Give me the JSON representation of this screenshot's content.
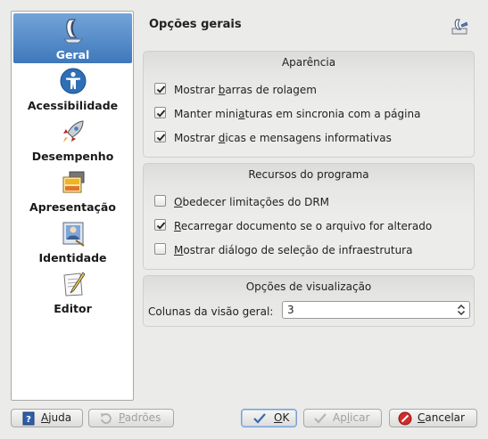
{
  "sidebar": {
    "items": [
      {
        "label": "Geral",
        "icon": "general-icon",
        "selected": true
      },
      {
        "label": "Acessibilidade",
        "icon": "accessibility-icon"
      },
      {
        "label": "Desempenho",
        "icon": "rocket-icon"
      },
      {
        "label": "Apresentação",
        "icon": "presentation-icon"
      },
      {
        "label": "Identidade",
        "icon": "identity-icon"
      },
      {
        "label": "Editor",
        "icon": "editor-icon"
      }
    ]
  },
  "header": {
    "title": "Opções gerais",
    "icon": "general-settings-icon"
  },
  "groups": {
    "appearance": {
      "title": "Aparência",
      "options": [
        {
          "pre": "Mostrar ",
          "mn": "b",
          "post": "arras de rolagem",
          "checked": true
        },
        {
          "pre": "Manter mini",
          "mn": "a",
          "post": "turas em sincronia com a página",
          "checked": true
        },
        {
          "pre": "Mostrar ",
          "mn": "d",
          "post": "icas e mensagens informativas",
          "checked": true
        }
      ]
    },
    "resources": {
      "title": "Recursos do programa",
      "options": [
        {
          "pre": "",
          "mn": "O",
          "post": "bedecer limitações do DRM",
          "checked": false
        },
        {
          "pre": "",
          "mn": "R",
          "post": "ecarregar documento se o arquivo for alterado",
          "checked": true
        },
        {
          "pre": "",
          "mn": "M",
          "post": "ostrar diálogo de seleção de infraestrutura",
          "checked": false
        }
      ]
    },
    "view": {
      "title": "Opções de visualização",
      "columns_label": "Colunas da visão geral:",
      "columns_value": "3"
    }
  },
  "buttons": {
    "help": {
      "mn": "A",
      "post": "juda"
    },
    "defaults": {
      "mn": "P",
      "post": "adrões"
    },
    "ok": {
      "mn": "O",
      "post": "K"
    },
    "apply": {
      "pre": "Ap",
      "mn": "l",
      "post": "icar"
    },
    "cancel": {
      "mn": "C",
      "post": "ancelar"
    }
  },
  "colors": {
    "selection": "#4f86c6",
    "cancel_icon": "#d22b2b",
    "check": "#1e1e1e"
  }
}
